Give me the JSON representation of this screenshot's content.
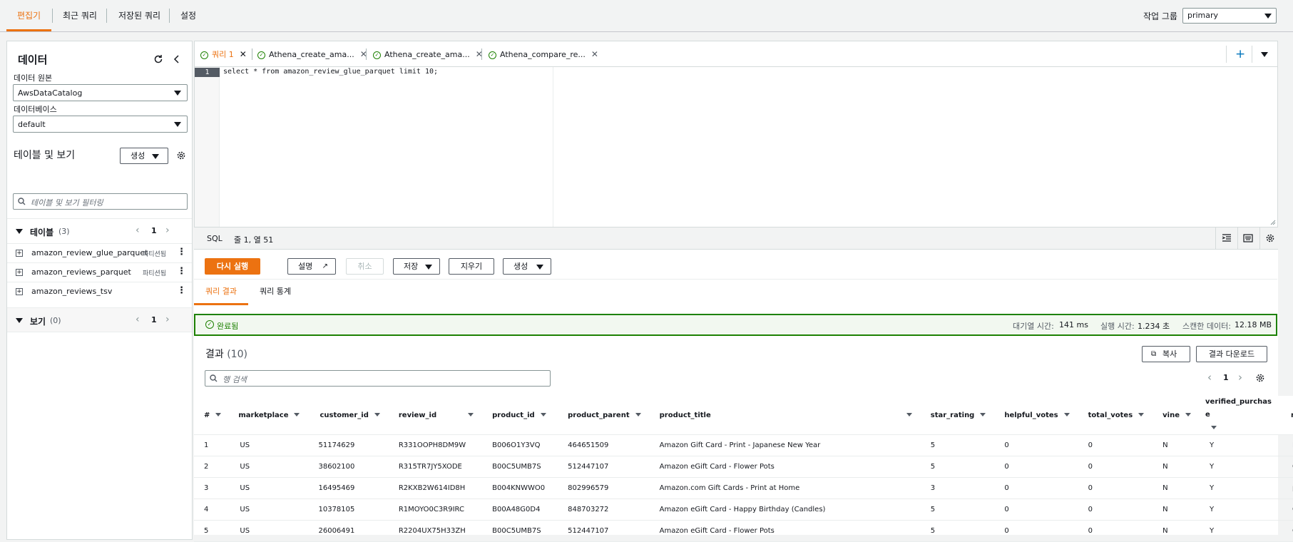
{
  "nav": {
    "tabs": [
      "편집기",
      "최근 쿼리",
      "저장된 쿼리",
      "설정"
    ],
    "workgroup_label": "작업 그룹",
    "workgroup_value": "primary"
  },
  "sidebar": {
    "title": "데이터",
    "datasource_label": "데이터 원본",
    "datasource_value": "AwsDataCatalog",
    "database_label": "데이터베이스",
    "database_value": "default",
    "tables_views_label": "테이블 및 보기",
    "create_label": "생성",
    "filter_placeholder": "테이블 및 보기 필터링",
    "tables_label": "테이블",
    "tables_count": "(3)",
    "page": "1",
    "tables": [
      {
        "name": "amazon_review_glue_parquet",
        "badge": "파티션됨"
      },
      {
        "name": "amazon_reviews_parquet",
        "badge": "파티션됨"
      },
      {
        "name": "amazon_reviews_tsv",
        "badge": ""
      }
    ],
    "views_label": "보기",
    "views_count": "(0)",
    "views_page": "1"
  },
  "editor": {
    "tabs": [
      "쿼리 1",
      "Athena_create_ama...",
      "Athena_create_ama...",
      "Athena_compare_re..."
    ],
    "line": "1",
    "code": "select * from amazon_review_glue_parquet limit 10;"
  },
  "status": {
    "lang": "SQL",
    "position": "줄 1, 열 51"
  },
  "actions": {
    "run": "다시 실행",
    "explain": "설명",
    "cancel": "취소",
    "save": "저장",
    "clear": "지우기",
    "create": "생성"
  },
  "results_tabs": [
    "쿼리 결과",
    "쿼리 통계"
  ],
  "completion": {
    "status": "완료됨",
    "queue_label": "대기열 시간:",
    "queue_value": "141 ms",
    "run_label": "실행 시간:",
    "run_value": "1.234 초",
    "scan_label": "스캔한 데이터:",
    "scan_value": "12.18 MB"
  },
  "results": {
    "title": "결과",
    "count": "(10)",
    "copy": "복사",
    "download": "결과 다운로드",
    "search_placeholder": "행 검색",
    "page": "1",
    "columns": [
      "#",
      "marketplace",
      "customer_id",
      "review_id",
      "product_id",
      "product_parent",
      "product_title",
      "star_rating",
      "helpful_votes",
      "total_votes",
      "vine",
      "verified_purchase",
      "review_he"
    ],
    "rows": [
      [
        "1",
        "US",
        "51174629",
        "R331OOPH8DM9W",
        "B006O1Y3VQ",
        "464651509",
        "Amazon Gift Card - Print - Japanese New Year",
        "5",
        "0",
        "0",
        "N",
        "Y",
        "Love Gift c"
      ],
      [
        "2",
        "US",
        "38602100",
        "R315TR7JY5XODE",
        "B00C5UMB7S",
        "512447107",
        "Amazon eGift Card - Flower Pots",
        "5",
        "0",
        "0",
        "N",
        "Y",
        "Gift Card"
      ],
      [
        "3",
        "US",
        "16495469",
        "R2KXB2W614ID8H",
        "B004KNWWO0",
        "802996579",
        "Amazon.com Gift Cards - Print at Home",
        "3",
        "0",
        "0",
        "N",
        "Y",
        "printed gi"
      ],
      [
        "4",
        "US",
        "10378105",
        "R1MOYO0C3R9IRC",
        "B00A48G0D4",
        "848703272",
        "Amazon eGift Card - Happy Birthday (Candles)",
        "5",
        "0",
        "0",
        "N",
        "Y",
        "Great item"
      ],
      [
        "5",
        "US",
        "26006491",
        "R2204UX75H33ZH",
        "B00C5UMB7S",
        "512447107",
        "Amazon eGift Card - Flower Pots",
        "5",
        "0",
        "0",
        "N",
        "Y",
        "Colorful"
      ]
    ]
  },
  "colors": {
    "accent": "#ec7211",
    "success": "#1d8102",
    "link": "#0073bb"
  }
}
